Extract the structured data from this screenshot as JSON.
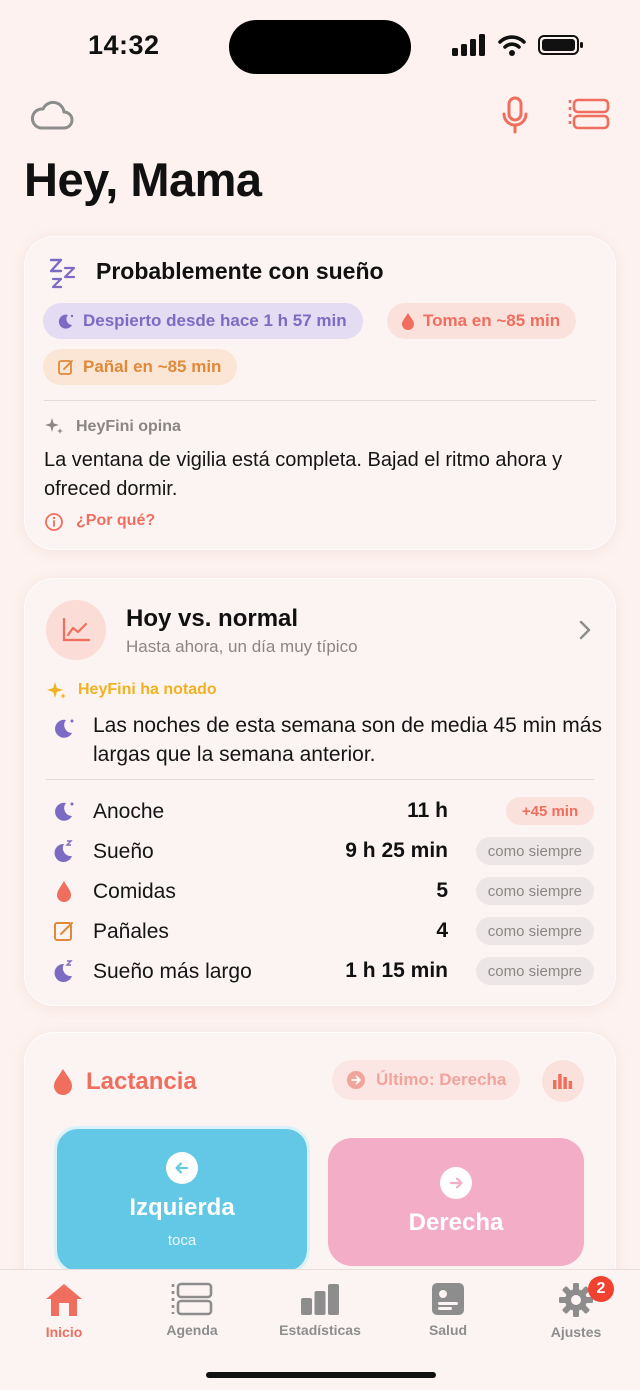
{
  "status_bar": {
    "time": "14:32"
  },
  "header": {
    "title": "Hey, Mama"
  },
  "state_card": {
    "title": "Probablemente con sueño",
    "chips": [
      {
        "label": "Despierto desde hace 1 h 57 min",
        "color": "#7c6bc4"
      },
      {
        "label": "Toma en ~85 min",
        "color": "#ef6e5e"
      },
      {
        "label": "Pañal en ~85 min",
        "color": "#e0893a"
      }
    ],
    "opinion_label": "HeyFini opina",
    "opinion_text": "La ventana de vigilia está completa. Bajad el ritmo ahora y ofreced dormir.",
    "why_label": "¿Por qué?"
  },
  "compare_card": {
    "title": "Hoy vs. normal",
    "subtitle": "Hasta ahora, un día muy típico",
    "noted_label": "HeyFini ha notado",
    "noted_text": "Las noches de esta semana son de media 45 min más largas que la semana anterior.",
    "rows": [
      {
        "icon": "moon-stars-icon",
        "label": "Anoche",
        "value": "11 h",
        "badge": "+45 min"
      },
      {
        "icon": "moon-zzz-icon",
        "label": "Sueño",
        "value": "9 h 25 min",
        "badge": "como siempre"
      },
      {
        "icon": "drop-icon",
        "label": "Comidas",
        "value": "5",
        "badge": "como siempre"
      },
      {
        "icon": "diaper-note-icon",
        "label": "Pañales",
        "value": "4",
        "badge": "como siempre"
      },
      {
        "icon": "moon-zzz-icon",
        "label": "Sueño más largo",
        "value": "1 h 15 min",
        "badge": "como siempre"
      }
    ]
  },
  "nursing_card": {
    "title": "Lactancia",
    "last_label": "Último: Derecha",
    "left_button": {
      "label": "Izquierda",
      "hint": "toca"
    },
    "right_button": {
      "label": "Derecha"
    }
  },
  "tab_bar": {
    "tabs": [
      {
        "label": "Inicio",
        "active": true
      },
      {
        "label": "Agenda"
      },
      {
        "label": "Estadísticas"
      },
      {
        "label": "Salud"
      },
      {
        "label": "Ajustes",
        "badge": "2"
      }
    ]
  },
  "colors": {
    "accent": "#ef6e5e",
    "purple": "#7c6bc4",
    "orange": "#e0893a",
    "yellow": "#f1b221",
    "left_side": "#63c8e6",
    "right_side": "#f3adc6"
  }
}
